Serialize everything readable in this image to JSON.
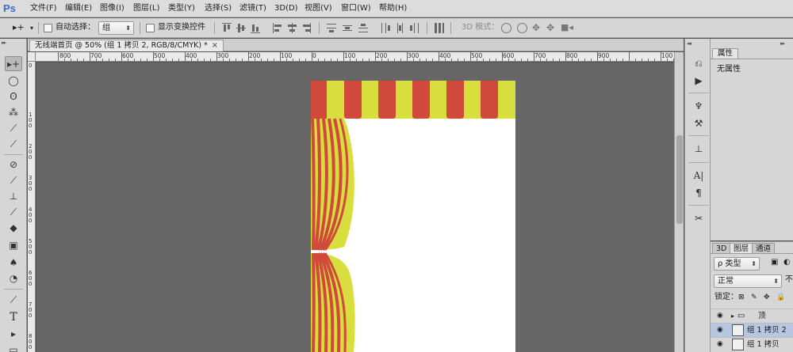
{
  "app": {
    "logo": "Ps"
  },
  "menu": [
    "文件(F)",
    "编辑(E)",
    "图像(I)",
    "图层(L)",
    "类型(Y)",
    "选择(S)",
    "滤镜(T)",
    "3D(D)",
    "视图(V)",
    "窗口(W)",
    "帮助(H)"
  ],
  "options": {
    "move_tool_glyph": "▸+",
    "auto_select_label": "自动选择：",
    "auto_select_value": "组",
    "show_transform_label": "显示变换控件",
    "mode3d_label": "3D 模式："
  },
  "document": {
    "tab_title": "无线端首页 @ 50% (组 1 拷贝 2, RGB/8/CMYK) *",
    "close": "×",
    "ruler_h": [
      "800",
      "700",
      "600",
      "500",
      "400",
      "300",
      "200",
      "100",
      "0",
      "100",
      "200",
      "300",
      "400",
      "500",
      "600",
      "700",
      "800",
      "900",
      "100"
    ],
    "ruler_v": [
      "0",
      "1 0 0",
      "2 0 0",
      "3 0 0",
      "4 0 0",
      "5 0 0",
      "6 0 0",
      "7 0 0",
      "8 0 0"
    ]
  },
  "artwork": {
    "red": "#cf4a3a",
    "yellow": "#d9de3f",
    "background": "#ffffff",
    "canvas": "#666666"
  },
  "properties": {
    "tab": "属性",
    "body": "无属性"
  },
  "layers_panel": {
    "tabs": [
      "3D",
      "图层",
      "通道"
    ],
    "filter_label": "ρ 类型",
    "blend_mode": "正常",
    "opacity_label": "不",
    "lock_label": "锁定：",
    "layers": [
      {
        "name": "顶",
        "type": "group",
        "expander": "▸"
      },
      {
        "name": "组 1 拷贝 2",
        "type": "smart",
        "selected": true
      },
      {
        "name": "组 1 拷贝",
        "type": "smart",
        "selected": false
      }
    ]
  },
  "icons": {
    "tools": [
      "move-tool-icon",
      "marquee-tool-icon",
      "lasso-tool-icon",
      "magic-wand-tool-icon",
      "crop-tool-icon",
      "eyedropper-tool-icon",
      "healing-brush-tool-icon",
      "brush-tool-icon",
      "clone-stamp-tool-icon",
      "history-brush-tool-icon",
      "eraser-tool-icon",
      "gradient-tool-icon",
      "blur-tool-icon",
      "dodge-tool-icon",
      "pen-tool-icon",
      "type-tool-icon",
      "path-selection-tool-icon",
      "shape-tool-icon"
    ],
    "strip": [
      "history-icon",
      "actions-icon",
      "brushes-icon",
      "tool-presets-icon",
      "clone-source-icon",
      "character-icon",
      "paragraph-icon",
      "properties-icon"
    ]
  }
}
